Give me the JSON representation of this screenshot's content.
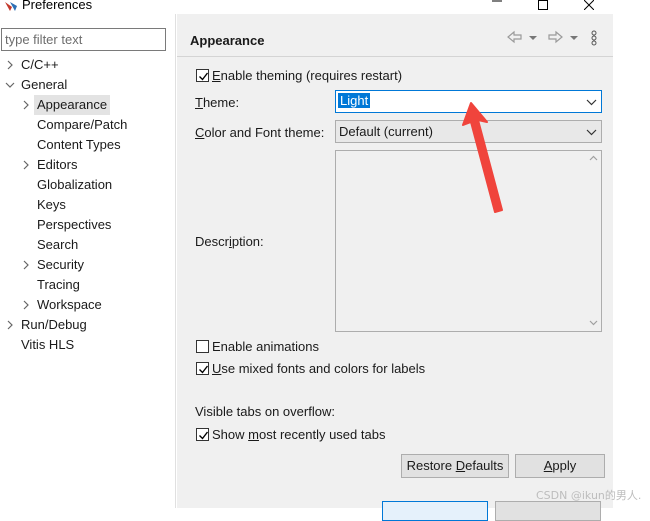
{
  "window": {
    "title": "Preferences",
    "minimize_icon": "minimize-icon",
    "maximize_icon": "maximize-icon",
    "close_icon": "close-icon"
  },
  "filter": {
    "placeholder": "type filter text",
    "value": ""
  },
  "tree": [
    {
      "label": "C/C++",
      "expandable": true,
      "expanded": false
    },
    {
      "label": "General",
      "expandable": true,
      "expanded": true
    },
    {
      "label": "Appearance",
      "expandable": true,
      "expanded": false,
      "selected": true
    },
    {
      "label": "Compare/Patch",
      "expandable": false
    },
    {
      "label": "Content Types",
      "expandable": false
    },
    {
      "label": "Editors",
      "expandable": true,
      "expanded": false
    },
    {
      "label": "Globalization",
      "expandable": false
    },
    {
      "label": "Keys",
      "expandable": false
    },
    {
      "label": "Perspectives",
      "expandable": false
    },
    {
      "label": "Search",
      "expandable": false
    },
    {
      "label": "Security",
      "expandable": true,
      "expanded": false
    },
    {
      "label": "Tracing",
      "expandable": false
    },
    {
      "label": "Workspace",
      "expandable": true,
      "expanded": false
    },
    {
      "label": "Run/Debug",
      "expandable": true,
      "expanded": false
    },
    {
      "label": "Vitis HLS",
      "expandable": false
    }
  ],
  "page": {
    "title": "Appearance",
    "enable_theming": {
      "prefix": "",
      "mnemonic": "E",
      "rest": "nable theming (requires restart)",
      "checked": true
    },
    "theme": {
      "label_mnemonic": "T",
      "label_rest": "heme:",
      "value": "Light"
    },
    "color_font_theme": {
      "label_prefix": "",
      "label_mnemonic": "C",
      "label_rest": "olor and Font theme:",
      "value": "Default (current)"
    },
    "description": {
      "label_prefix": "Descr",
      "label_mnemonic": "i",
      "label_rest": "ption:"
    },
    "enable_animations": {
      "label": "Enable animations",
      "checked": false
    },
    "mixed_fonts": {
      "prefix": "",
      "mnemonic": "U",
      "rest": "se mixed fonts and colors for labels",
      "checked": true
    },
    "visible_tabs_label": "Visible tabs on overflow:",
    "show_recent_tabs": {
      "prefix": "Show ",
      "mnemonic": "m",
      "rest": "ost recently used tabs",
      "checked": true
    },
    "restore_defaults": {
      "prefix": "Restore ",
      "mnemonic": "D",
      "rest": "efaults"
    },
    "apply": {
      "mnemonic": "A",
      "rest": "pply"
    }
  },
  "watermark": "CSDN @ikun的男人.",
  "colors": {
    "accent": "#0078d7",
    "selection": "#e3e3e3",
    "annotation_arrow": "#f0443c",
    "panel_bg": "#f0f0f0"
  }
}
